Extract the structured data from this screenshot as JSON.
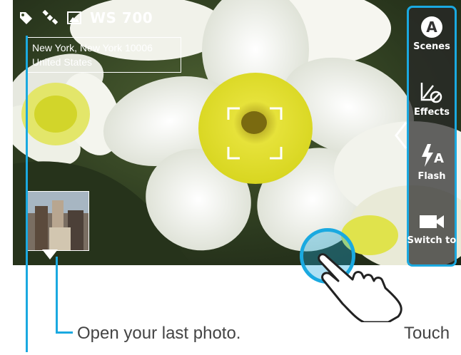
{
  "status_bar": {
    "tag_icon": "tag-icon",
    "gps_icon": "satellite-icon",
    "image_icon": "image-icon",
    "resolution_label": "WS 700"
  },
  "location": {
    "line1": "New York, New York 10006",
    "line2": "United States"
  },
  "side_panel": {
    "items": [
      {
        "label": "Scenes",
        "icon": "scenes-auto-icon"
      },
      {
        "label": "Effects",
        "icon": "effects-icon"
      },
      {
        "label": "Flash",
        "icon": "flash-auto-icon"
      },
      {
        "label": "Switch to",
        "icon": "video-camera-icon"
      }
    ]
  },
  "captions": {
    "open_last_photo": "Open your last photo.",
    "touch": "Touch"
  },
  "colors": {
    "callout": "#1aa9e0",
    "caption_text": "#444444"
  }
}
